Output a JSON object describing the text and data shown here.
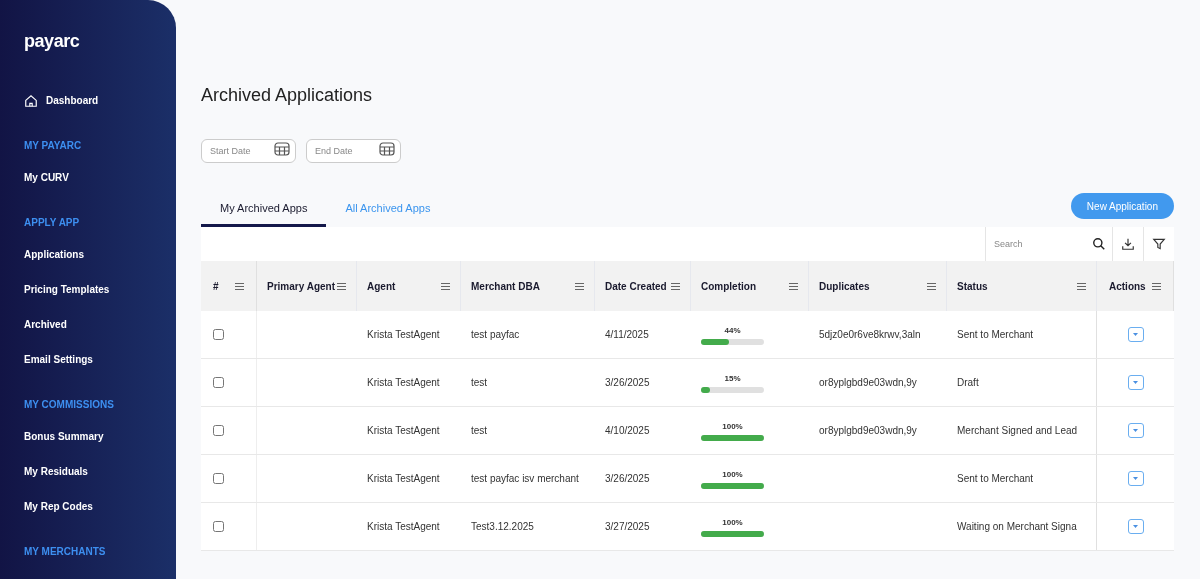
{
  "sidebar": {
    "logo": "payarc",
    "items": [
      {
        "kind": "link",
        "label": "Dashboard"
      },
      {
        "kind": "heading",
        "label": "MY PAYARC"
      },
      {
        "kind": "link",
        "label": "My CURV"
      },
      {
        "kind": "heading",
        "label": "APPLY APP"
      },
      {
        "kind": "link",
        "label": "Applications"
      },
      {
        "kind": "link",
        "label": "Pricing Templates"
      },
      {
        "kind": "link",
        "label": "Archived"
      },
      {
        "kind": "link",
        "label": "Email Settings"
      },
      {
        "kind": "heading",
        "label": "MY COMMISSIONS"
      },
      {
        "kind": "link",
        "label": "Bonus Summary"
      },
      {
        "kind": "link",
        "label": "My Residuals"
      },
      {
        "kind": "link",
        "label": "My Rep Codes"
      },
      {
        "kind": "heading",
        "label": "MY MERCHANTS"
      }
    ]
  },
  "page": {
    "title": "Archived Applications",
    "date_fields": [
      {
        "placeholder": "Start Date"
      },
      {
        "placeholder": "End Date"
      }
    ]
  },
  "tabs": [
    {
      "label": "My Archived Apps",
      "selected": true
    },
    {
      "label": "All Archived Apps",
      "selected": false
    }
  ],
  "new_button": "New Application",
  "search": {
    "placeholder": "Search"
  },
  "table": {
    "columns": [
      "#",
      "Primary Agent",
      "Agent",
      "Merchant DBA",
      "Date Created",
      "Completion",
      "Duplicates",
      "Status",
      "Actions"
    ],
    "rows": [
      {
        "checked": false,
        "agent": "Krista TestAgent",
        "merchant_dba": "test payfac",
        "date_created": "4/11/2025",
        "completion": "44%",
        "level": 0.44,
        "duplicates": "5djz0e0r6ve8krwv,3aln",
        "status": "Sent to Merchant"
      },
      {
        "checked": false,
        "agent": "Krista TestAgent",
        "merchant_dba": "test",
        "date_created": "3/26/2025",
        "completion": "15%",
        "level": 0.15,
        "duplicates": "or8yplgbd9e03wdn,9y",
        "status": "Draft"
      },
      {
        "checked": false,
        "agent": "Krista TestAgent",
        "merchant_dba": "test",
        "date_created": "4/10/2025",
        "completion": "100%",
        "level": 1,
        "duplicates": "or8yplgbd9e03wdn,9y",
        "status": "Merchant Signed and Lead"
      },
      {
        "checked": false,
        "agent": "Krista TestAgent",
        "merchant_dba": "test payfac isv merchant",
        "date_created": "3/26/2025",
        "completion": "100%",
        "level": 1,
        "status": "Sent to Merchant"
      },
      {
        "checked": false,
        "agent": "Krista TestAgent",
        "merchant_dba": "Test3.12.2025",
        "date_created": "3/27/2025",
        "completion": "100%",
        "level": 1,
        "status": "Waiting on Merchant Signa"
      }
    ]
  }
}
